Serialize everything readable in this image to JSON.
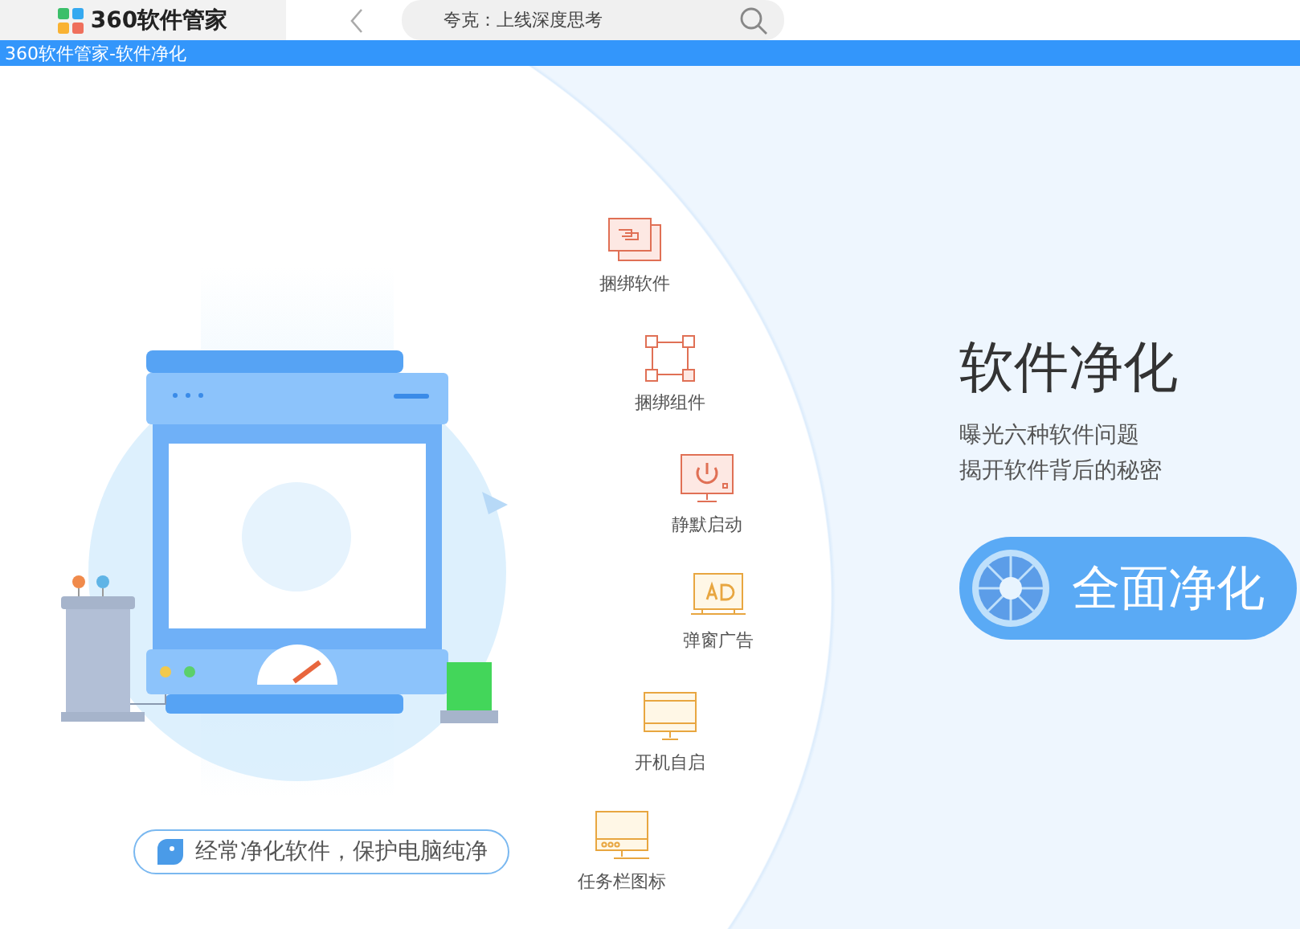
{
  "tab": {
    "logo_text": "360软件管家"
  },
  "search": {
    "placeholder": "夸克：上线深度思考"
  },
  "window": {
    "title": "360软件管家-软件净化"
  },
  "problems": [
    {
      "kind": "bundle-software",
      "label": "捆绑软件"
    },
    {
      "kind": "bundle-component",
      "label": "捆绑组件"
    },
    {
      "kind": "silent-start",
      "label": "静默启动"
    },
    {
      "kind": "popup-ad",
      "label": "弹窗广告"
    },
    {
      "kind": "autostart",
      "label": "开机自启"
    },
    {
      "kind": "tray-icon",
      "label": "任务栏图标"
    }
  ],
  "hero": {
    "title": "软件净化",
    "subtitle_lines": [
      "曝光六种软件问题",
      "揭开软件背后的秘密"
    ],
    "action": "全面净化"
  },
  "tip": "经常净化软件，保护电脑纯净"
}
